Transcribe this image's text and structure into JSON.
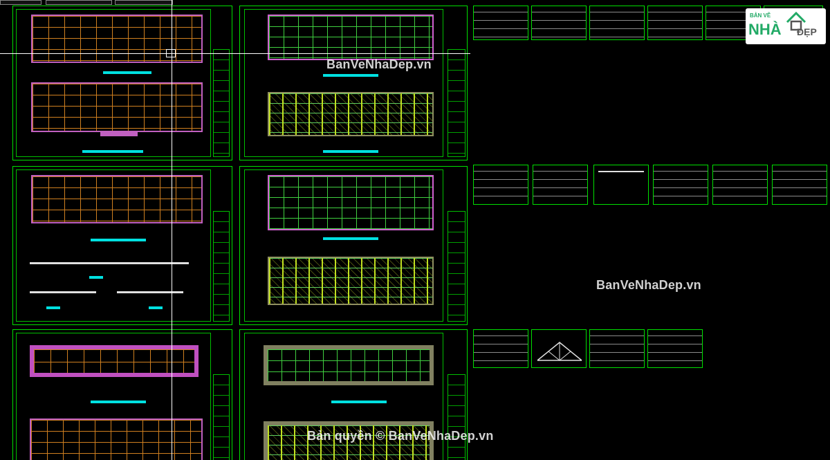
{
  "app": {
    "type": "cad-drawing-viewer",
    "background_color": "#000000",
    "frame_color": "#00e000"
  },
  "watermarks": {
    "top": "BanVeNhaDep.vn",
    "middle": "BanVeNhaDep.vn",
    "bottom": "Bản quyền © BanVeNhaDep.vn"
  },
  "logo": {
    "small_text": "BẢN VẼ",
    "main_text": "NHÀ",
    "tail_text": "ĐẸP",
    "color": "#22aa66"
  },
  "colors": {
    "grid_orange": "#d08020",
    "wall_pink": "#c050c0",
    "dimension_cyan": "#00e0e0",
    "rebar_yellow_green": "#c0e020",
    "frame_green": "#00e000"
  }
}
